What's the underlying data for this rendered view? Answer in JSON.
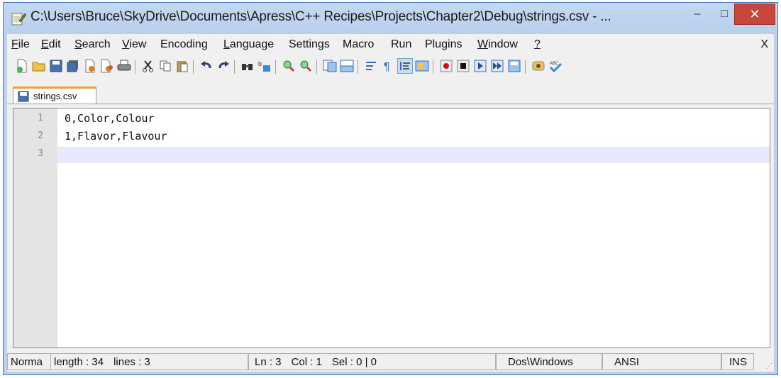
{
  "window": {
    "title": "C:\\Users\\Bruce\\SkyDrive\\Documents\\Apress\\C++ Recipes\\Projects\\Chapter2\\Debug\\strings.csv - ...",
    "minimize_glyph": "–",
    "maximize_glyph": "□",
    "close_glyph": "✕"
  },
  "menu": {
    "items": [
      {
        "label": "File",
        "u": "F",
        "rest": "ile"
      },
      {
        "label": "Edit",
        "u": "E",
        "rest": "dit"
      },
      {
        "label": "Search",
        "u": "S",
        "rest": "earch"
      },
      {
        "label": "View",
        "u": "V",
        "rest": "iew"
      },
      {
        "label": "Encoding",
        "u": "",
        "rest": "Encoding"
      },
      {
        "label": "Language",
        "u": "L",
        "rest": "anguage"
      },
      {
        "label": "Settings",
        "u": "",
        "rest": "Settings"
      },
      {
        "label": "Macro",
        "u": "",
        "rest": "Macro"
      },
      {
        "label": "Run",
        "u": "",
        "rest": "Run"
      },
      {
        "label": "Plugins",
        "u": "",
        "rest": "Plugins"
      },
      {
        "label": "Window",
        "u": "W",
        "rest": "indow"
      },
      {
        "label": "?",
        "u": "?",
        "rest": ""
      }
    ],
    "close_doc": "X"
  },
  "tab": {
    "label": "strings.csv"
  },
  "editor": {
    "line_numbers": [
      "1",
      "2",
      "3"
    ],
    "lines": [
      "0,Color,Colour",
      "1,Flavor,Flavour",
      ""
    ]
  },
  "status": {
    "lang": "Norma",
    "length": "length : 34",
    "lines": "lines : 3",
    "ln": "Ln : 3",
    "col": "Col : 1",
    "sel": "Sel : 0 | 0",
    "eol": "Dos\\Windows",
    "encoding": "ANSI",
    "mode": "INS"
  },
  "colors": {
    "titlebar": "#bcd1ee",
    "close_button": "#c7463e",
    "current_line": "#e8e8ff",
    "tab_accent": "#f0a030"
  }
}
